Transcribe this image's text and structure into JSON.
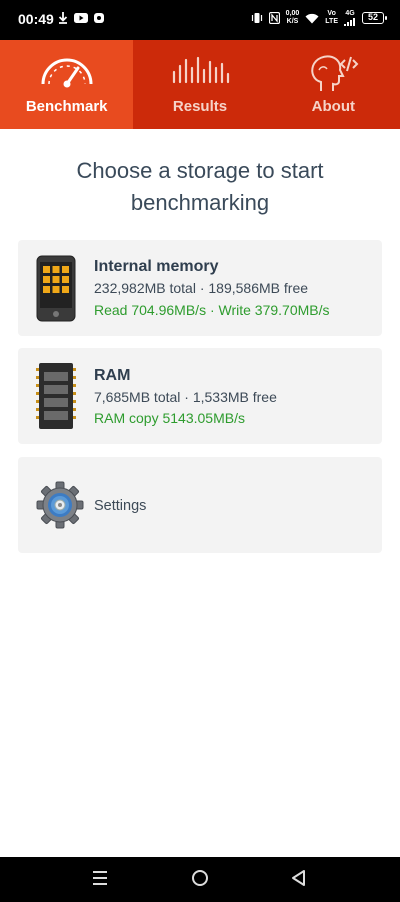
{
  "status_bar": {
    "time": "00:49",
    "speed_value": "0,00",
    "speed_unit": "K/S",
    "net_top": "Vo",
    "net_bottom": "LTE",
    "signal": "4G",
    "battery": "52"
  },
  "tabs": [
    {
      "label": "Benchmark",
      "icon": "speedometer-icon",
      "active": true
    },
    {
      "label": "Results",
      "icon": "bars-icon",
      "active": false
    },
    {
      "label": "About",
      "icon": "head-code-icon",
      "active": false
    }
  ],
  "heading": "Choose a storage to start benchmarking",
  "storages": {
    "internal": {
      "title": "Internal memory",
      "sub": "232,982MB total · 189,586MB free",
      "speed": "Read 704.96MB/s · Write 379.70MB/s"
    },
    "ram": {
      "title": "RAM",
      "sub": "7,685MB total · 1,533MB free",
      "speed": "RAM copy 5143.05MB/s"
    }
  },
  "settings": {
    "label": "Settings"
  },
  "colors": {
    "tab_bar": "#cc2a0a",
    "tab_active": "#e84b1f",
    "speed_text": "#2e9c2e"
  }
}
